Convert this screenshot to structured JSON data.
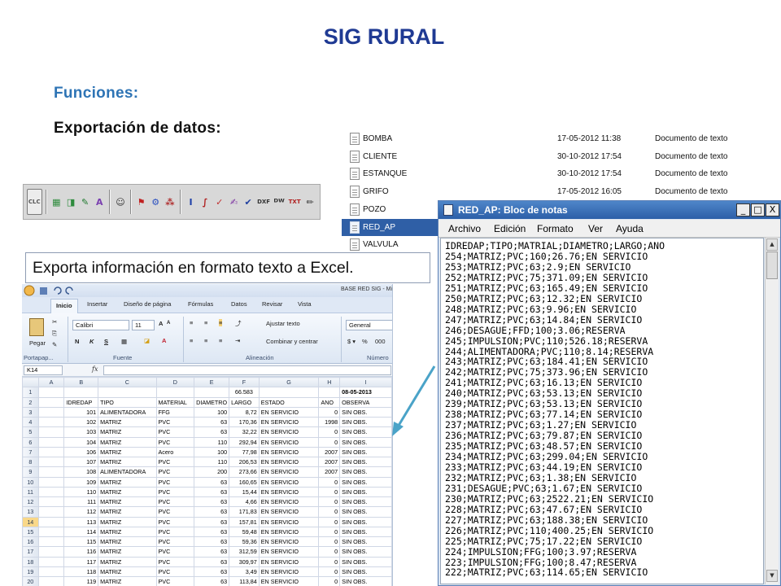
{
  "slide": {
    "title": "SIG RURAL",
    "subtitle": "Funciones:",
    "section": "Exportación de datos:",
    "callout": "Exporta información en formato texto a Excel."
  },
  "toolbar": {
    "buttons": [
      {
        "name": "clc",
        "label": "CLC",
        "color": "#555555"
      },
      {
        "name": "sep"
      },
      {
        "name": "layout-grid",
        "label": "▦",
        "color": "#2e8b3d"
      },
      {
        "name": "layout-alt",
        "label": "◨",
        "color": "#2e8b3d"
      },
      {
        "name": "pencil",
        "label": "✎",
        "color": "#1f7a2e"
      },
      {
        "name": "draw",
        "label": "A",
        "color": "#7a3fb0"
      },
      {
        "name": "sep"
      },
      {
        "name": "smiley",
        "label": "☺",
        "color": "#333333"
      },
      {
        "name": "sep"
      },
      {
        "name": "route",
        "label": "⚑",
        "color": "#c02020"
      },
      {
        "name": "network",
        "label": "⚙",
        "color": "#2a4fc0"
      },
      {
        "name": "nodes",
        "label": "⁂",
        "color": "#b03030"
      },
      {
        "name": "sep"
      },
      {
        "name": "info",
        "label": "I",
        "color": "#1e3fa8"
      },
      {
        "name": "brush",
        "label": "∫",
        "color": "#b02020"
      },
      {
        "name": "check",
        "label": "✓",
        "color": "#c03030"
      },
      {
        "name": "edit",
        "label": "✍",
        "color": "#7a2fa0"
      },
      {
        "name": "tick",
        "label": "✔",
        "color": "#2040a0"
      },
      {
        "name": "dxf",
        "label": "DXF",
        "color": "#333333"
      },
      {
        "name": "dwg",
        "label": "ᴰᵂ",
        "color": "#333333"
      },
      {
        "name": "txt",
        "label": "TXT",
        "color": "#b02020"
      },
      {
        "name": "pen",
        "label": "✏",
        "color": "#333333"
      }
    ]
  },
  "file_list": [
    {
      "name": "BOMBA",
      "date": "17-05-2012 11:38",
      "type": "Documento de texto",
      "selected": false
    },
    {
      "name": "CLIENTE",
      "date": "30-10-2012 17:54",
      "type": "Documento de texto",
      "selected": false
    },
    {
      "name": "ESTANQUE",
      "date": "30-10-2012 17:54",
      "type": "Documento de texto",
      "selected": false
    },
    {
      "name": "GRIFO",
      "date": "17-05-2012 16:05",
      "type": "Documento de texto",
      "selected": false
    },
    {
      "name": "POZO",
      "date": "",
      "type": "",
      "selected": false
    },
    {
      "name": "RED_AP",
      "date": "",
      "type": "",
      "selected": true
    },
    {
      "name": "VALVULA",
      "date": "",
      "type": "",
      "selected": false
    }
  ],
  "notepad": {
    "title": "RED_AP: Bloc de notas",
    "controls": [
      "_",
      "□",
      "X"
    ],
    "menu": [
      "Archivo",
      "Edición",
      "Formato",
      "Ver",
      "Ayuda"
    ],
    "lines": [
      "IDREDAP;TIPO;MATRIAL;DIAMETRO;LARGO;ANO",
      "254;MATRIZ;PVC;160;26.76;EN SERVICIO",
      "253;MATRIZ;PVC;63;2.9;EN SERVICIO",
      "252;MATRIZ;PVC;75;371.09;EN SERVICIO",
      "251;MATRIZ;PVC;63;165.49;EN SERVICIO",
      "250;MATRIZ;PVC;63;12.32;EN SERVICIO",
      "248;MATRIZ;PVC;63;9.96;EN SERVICIO",
      "247;MATRIZ;PVC;63;14.84;EN SERVICIO",
      "246;DESAGUE;FFD;100;3.06;RESERVA",
      "245;IMPULSION;PVC;110;526.18;RESERVA",
      "244;ALIMENTADORA;PVC;110;8.14;RESERVA",
      "243;MATRIZ;PVC;63;184.41;EN SERVICIO",
      "242;MATRIZ;PVC;75;373.96;EN SERVICIO",
      "241;MATRIZ;PVC;63;16.13;EN SERVICIO",
      "240;MATRIZ;PVC;63;53.13;EN SERVICIO",
      "239;MATRIZ;PVC;63;53.13;EN SERVICIO",
      "238;MATRIZ;PVC;63;77.14;EN SERVICIO",
      "237;MATRIZ;PVC;63;1.27;EN SERVICIO",
      "236;MATRIZ;PVC;63;79.87;EN SERVICIO",
      "235;MATRIZ;PVC;63;48.57;EN SERVICIO",
      "234;MATRIZ;PVC;63;299.04;EN SERVICIO",
      "233;MATRIZ;PVC;63;44.19;EN SERVICIO",
      "232;MATRIZ;PVC;63;1.38;EN SERVICIO",
      "231;DESAGUE;PVC;63;1.67;EN SERVICIO",
      "230;MATRIZ;PVC;63;2522.21;EN SERVICIO",
      "228;MATRIZ;PVC;63;47.67;EN SERVICIO",
      "227;MATRIZ;PVC;63;188.38;EN SERVICIO",
      "226;MATRIZ;PVC;110;400.25;EN SERVICIO",
      "225;MATRIZ;PVC;75;17.22;EN SERVICIO",
      "224;IMPULSION;FFG;100;3.97;RESERVA",
      "223;IMPULSION;FFG;100;8.47;RESERVA",
      "222;MATRIZ;PVC;63;114.65;EN SERVICIO"
    ]
  },
  "excel": {
    "filename": "BASE RED SIG - Mi",
    "tabs": [
      "Inicio",
      "Insertar",
      "Diseño de página",
      "Fórmulas",
      "Datos",
      "Revisar",
      "Vista"
    ],
    "active_tab": "Inicio",
    "ribbon": {
      "paste": "Pegar",
      "font_name": "Calibri",
      "font_size": "11",
      "wrap_text": "Ajustar texto",
      "merge_center": "Combinar y centrar",
      "number_format": "General",
      "groups": [
        "Portapap...",
        "Fuente",
        "Alineación",
        "Número"
      ]
    },
    "name_box": "K14",
    "fx": "fx",
    "columns": [
      "",
      "A",
      "B",
      "C",
      "D",
      "E",
      "F",
      "G",
      "H",
      "I"
    ],
    "selected_row": "14",
    "rows": [
      [
        "1",
        "",
        "",
        "",
        "",
        "",
        "66.583",
        "",
        "",
        "08-05-2013"
      ],
      [
        "2",
        "",
        "IDREDAP",
        "TIPO",
        "MATERIAL",
        "DIAMETRO",
        "LARGO",
        "ESTADO",
        "ANO",
        "OBSERVA"
      ],
      [
        "3",
        "",
        "101",
        "ALIMENTADORA",
        "FFG",
        "100",
        "8,72",
        "EN SERVICIO",
        "0",
        "SIN OBS."
      ],
      [
        "4",
        "",
        "102",
        "MATRIZ",
        "PVC",
        "63",
        "170,36",
        "EN SERVICIO",
        "1998",
        "SIN OBS."
      ],
      [
        "5",
        "",
        "103",
        "MATRIZ",
        "PVC",
        "63",
        "32,22",
        "EN SERVICIO",
        "0",
        "SIN OBS."
      ],
      [
        "6",
        "",
        "104",
        "MATRIZ",
        "PVC",
        "110",
        "292,94",
        "EN SERVICIO",
        "0",
        "SIN OBS."
      ],
      [
        "7",
        "",
        "106",
        "MATRIZ",
        "Acero",
        "100",
        "77,98",
        "EN SERVICIO",
        "2007",
        "SIN OBS."
      ],
      [
        "8",
        "",
        "107",
        "MATRIZ",
        "PVC",
        "110",
        "206,53",
        "EN SERVICIO",
        "2007",
        "SIN OBS."
      ],
      [
        "9",
        "",
        "108",
        "ALIMENTADORA",
        "PVC",
        "200",
        "273,66",
        "EN SERVICIO",
        "2007",
        "SIN OBS."
      ],
      [
        "10",
        "",
        "109",
        "MATRIZ",
        "PVC",
        "63",
        "160,65",
        "EN SERVICIO",
        "0",
        "SIN OBS."
      ],
      [
        "11",
        "",
        "110",
        "MATRIZ",
        "PVC",
        "63",
        "15,44",
        "EN SERVICIO",
        "0",
        "SIN OBS."
      ],
      [
        "12",
        "",
        "111",
        "MATRIZ",
        "PVC",
        "63",
        "4,66",
        "EN SERVICIO",
        "0",
        "SIN OBS."
      ],
      [
        "13",
        "",
        "112",
        "MATRIZ",
        "PVC",
        "63",
        "171,83",
        "EN SERVICIO",
        "0",
        "SIN OBS."
      ],
      [
        "14",
        "",
        "113",
        "MATRIZ",
        "PVC",
        "63",
        "157,81",
        "EN SERVICIO",
        "0",
        "SIN OBS."
      ],
      [
        "15",
        "",
        "114",
        "MATRIZ",
        "PVC",
        "63",
        "59,48",
        "EN SERVICIO",
        "0",
        "SIN OBS."
      ],
      [
        "16",
        "",
        "115",
        "MATRIZ",
        "PVC",
        "63",
        "59,36",
        "EN SERVICIO",
        "0",
        "SIN OBS."
      ],
      [
        "17",
        "",
        "116",
        "MATRIZ",
        "PVC",
        "63",
        "312,59",
        "EN SERVICIO",
        "0",
        "SIN OBS."
      ],
      [
        "18",
        "",
        "117",
        "MATRIZ",
        "PVC",
        "63",
        "309,97",
        "EN SERVICIO",
        "0",
        "SIN OBS."
      ],
      [
        "19",
        "",
        "118",
        "MATRIZ",
        "PVC",
        "63",
        "3,49",
        "EN SERVICIO",
        "0",
        "SIN OBS."
      ],
      [
        "20",
        "",
        "119",
        "MATRIZ",
        "PVC",
        "63",
        "113,84",
        "EN SERVICIO",
        "0",
        "SIN OBS."
      ]
    ]
  },
  "colors": {
    "title": "#1f3a93",
    "subtitle": "#2e74b5",
    "selection": "#2f5fa6",
    "arrow": "#4aa3c8"
  }
}
